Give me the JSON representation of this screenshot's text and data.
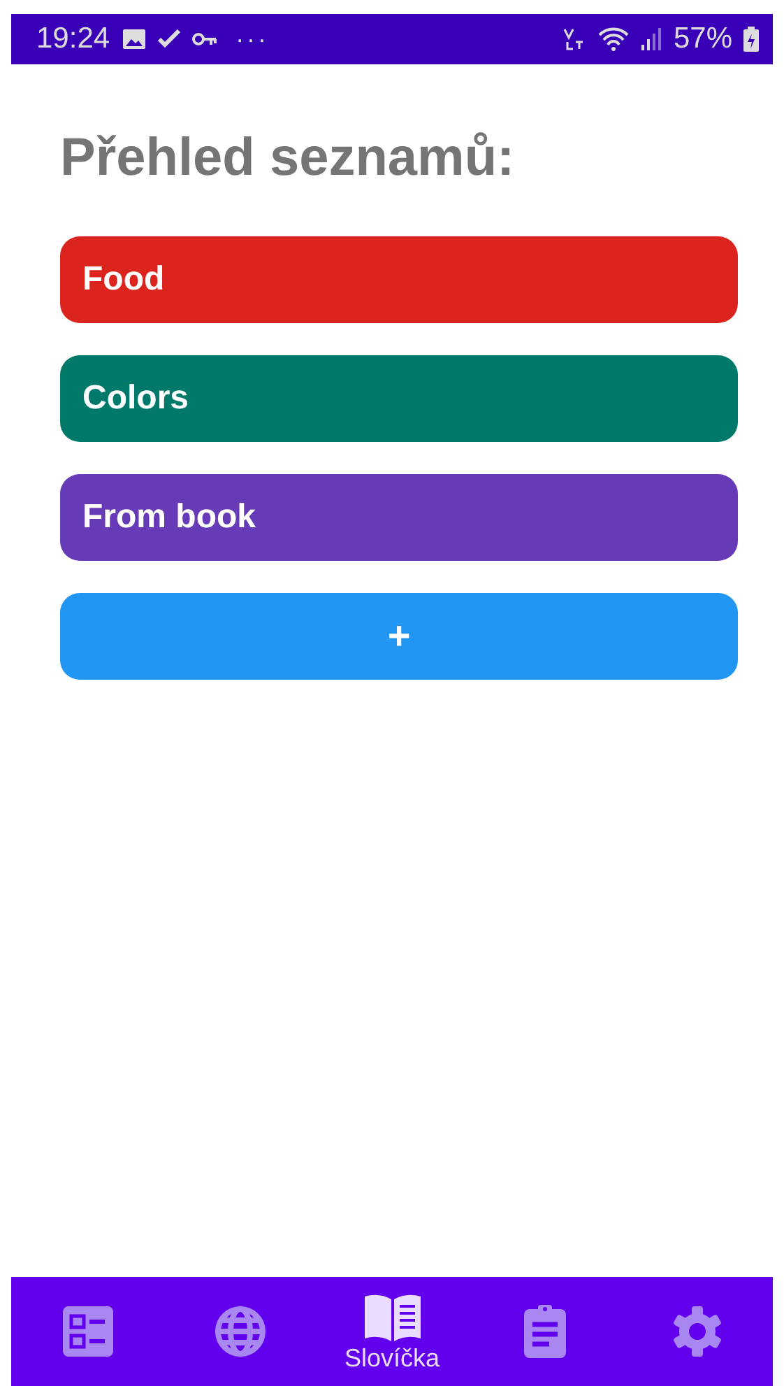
{
  "status_bar": {
    "time": "19:24",
    "more": "···",
    "battery": "57%"
  },
  "title": "Přehled seznamů:",
  "lists": [
    {
      "name": "Food",
      "color": "#dc241f"
    },
    {
      "name": "Colors",
      "color": "#00796b"
    },
    {
      "name": "From book",
      "color": "#673ab7"
    }
  ],
  "add_button": {
    "label": "+"
  },
  "bottom_nav": [
    {
      "kind": "checklist",
      "selected": false
    },
    {
      "kind": "globe",
      "selected": false
    },
    {
      "kind": "book",
      "selected": true,
      "label": "Slovíčka"
    },
    {
      "kind": "clipboard",
      "selected": false
    },
    {
      "kind": "settings",
      "selected": false
    }
  ]
}
